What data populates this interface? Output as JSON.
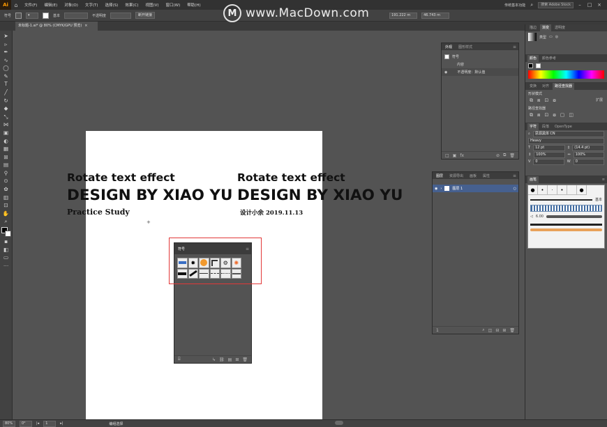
{
  "menubar": {
    "logo": "Ai",
    "menus": [
      "文件(F)",
      "编辑(E)",
      "对象(O)",
      "文字(T)",
      "选择(S)",
      "效果(C)",
      "视图(V)",
      "窗口(W)",
      "帮助(H)"
    ],
    "workspace": "传统基本功能",
    "search_placeholder": "搜索 Adobe Stock"
  },
  "controlbar": {
    "group_label": "符号",
    "style_label": "基本",
    "opacity_label": "不透明度",
    "button_label": "断开链接",
    "x_value": "191.222 m",
    "y_value": "46.743 m"
  },
  "document_tab": {
    "title": "未标题-1.ai* @ 80% (CMYK/GPU 预览)",
    "close": "×"
  },
  "artboard": {
    "left_block": {
      "heading": "Rotate text effect",
      "title": "DESIGN BY XIAO YU",
      "subtitle": "Practice  Study"
    },
    "right_block": {
      "heading": "Rotate text effect",
      "title": "DESIGN BY XIAO YU",
      "subtitle": "设计小余  2019.11.13"
    }
  },
  "appearance_panel": {
    "tabs": [
      "外观",
      "图形样式"
    ],
    "rows": [
      "符号",
      "内容",
      "不透明度：默认值"
    ]
  },
  "layers_panel": {
    "tabs": [
      "图层",
      "资源导出",
      "画板",
      "属性"
    ],
    "layer_name": "图层 1"
  },
  "symbols_panel": {
    "title": "符号",
    "symbol_names": [
      "blue-banner-symbol",
      "black-splat-symbol",
      "orange-burst-symbol",
      "corner-frame-symbol",
      "gear-outline-symbol",
      "orange-sun-symbol",
      "black-stripe-symbol",
      "diagonal-bar-symbol",
      "thin-line-symbol",
      "dash-line-symbol",
      "dots-line-symbol",
      "rule-line-symbol"
    ]
  },
  "right_dock": {
    "top_tabs": [
      "描边",
      "渐变",
      "透明度"
    ],
    "gradient_type_label": "类型",
    "color_tabs": [
      "颜色",
      "颜色参考"
    ],
    "transform_tabs": [
      "变换",
      "对齐",
      "路径查找器"
    ],
    "shape_mode_label": "形状模式",
    "pathfinder_label": "路径查找器",
    "character_tabs": [
      "字符",
      "段落",
      "OpenType"
    ],
    "font_name": "思源黑体 CN",
    "font_style": "Heavy",
    "font_size": "12 pt",
    "leading": "(14.4 pt)",
    "scale_h": "100%",
    "scale_v": "100%",
    "tracking": "0",
    "kerning": "0",
    "brushes_tab": "画笔",
    "brush_basic": "基本",
    "brush_size": "6.00"
  },
  "statusbar": {
    "zoom": "80%",
    "angle": "0°",
    "artboard_num": "1",
    "tool_name": "编组选择"
  },
  "watermark": {
    "text": "www.MacDown.com"
  },
  "colors": {
    "highlight": "#e23838",
    "layer_selected": "#46608f",
    "ai_orange": "#ff9a00"
  }
}
